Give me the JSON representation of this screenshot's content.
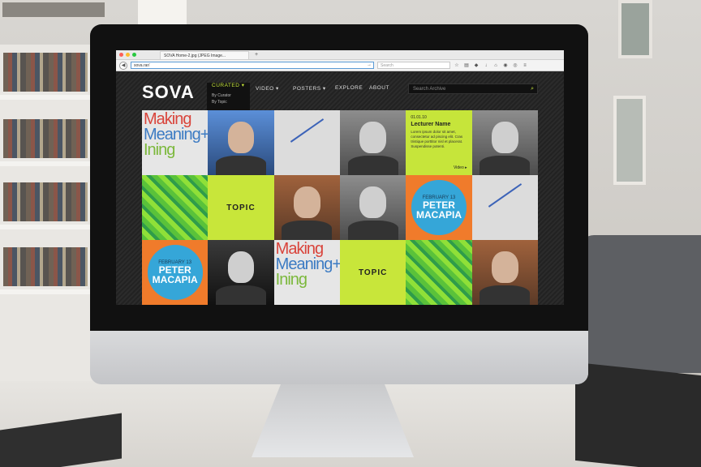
{
  "browser": {
    "tab_title": "SOVA Home-2.jpg (JPEG Image...",
    "new_tab": "+",
    "url": "sova.rar/",
    "search_placeholder": "Search"
  },
  "site": {
    "logo": "SOVA",
    "menu": [
      {
        "label": "CURATED ▾"
      },
      {
        "label": "VIDEO ▾"
      },
      {
        "label": "POSTERS ▾"
      },
      {
        "label": "EXPLORE"
      },
      {
        "label": "ABOUT"
      }
    ],
    "submenu": [
      "By Curator",
      "By Topic"
    ],
    "search_placeholder": "Search Archive",
    "tiles": {
      "making_meaning": [
        "Making",
        "Meaning+",
        "Ining"
      ],
      "topic_label": "TOPIC",
      "macapia_date": "FEBRUARY 13",
      "macapia_name": "PETER MACAPIA",
      "lecturer_date": "01.01.10",
      "lecturer_name": "Lecturer Name",
      "lecturer_text": "Lorem ipsum dolor sit amet, consectetur ad piscing elit. Cras tristique porttitor nisl et placerat. Suspendisse potenti.",
      "lecturer_link": "Video ▸"
    }
  }
}
